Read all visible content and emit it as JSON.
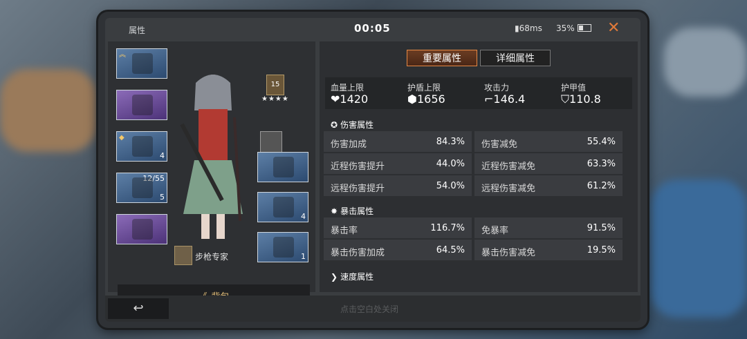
{
  "window": {
    "title": "属性",
    "time": "00:05",
    "ping": "68ms",
    "battery": "35%"
  },
  "tabs": [
    {
      "label": "重要属性",
      "active": true
    },
    {
      "label": "详细属性",
      "active": false
    }
  ],
  "summary": [
    {
      "label": "血量上限",
      "value": "1420",
      "icon": "heart-icon"
    },
    {
      "label": "护盾上限",
      "value": "1656",
      "icon": "shield-icon"
    },
    {
      "label": "攻击力",
      "value": "146.4",
      "icon": "gun-icon"
    },
    {
      "label": "护甲值",
      "value": "110.8",
      "icon": "armor-icon"
    }
  ],
  "sections": {
    "damage": {
      "title": "伤害属性",
      "rows": [
        [
          {
            "label": "伤害加成",
            "value": "84.3%"
          },
          {
            "label": "伤害减免",
            "value": "55.4%"
          }
        ],
        [
          {
            "label": "近程伤害提升",
            "value": "44.0%"
          },
          {
            "label": "近程伤害减免",
            "value": "63.3%"
          }
        ],
        [
          {
            "label": "远程伤害提升",
            "value": "54.0%"
          },
          {
            "label": "远程伤害减免",
            "value": "61.2%"
          }
        ]
      ]
    },
    "crit": {
      "title": "暴击属性",
      "rows": [
        [
          {
            "label": "暴击率",
            "value": "116.7%"
          },
          {
            "label": "免暴率",
            "value": "91.5%"
          }
        ],
        [
          {
            "label": "暴击伤害加成",
            "value": "64.5%"
          },
          {
            "label": "暴击伤害减免",
            "value": "19.5%"
          }
        ]
      ]
    },
    "speed": {
      "title": "速度属性"
    }
  },
  "character": {
    "level": "15",
    "stars": "★★★★",
    "spec": "步枪专家"
  },
  "slots": {
    "weapon1_ammo": "12/55",
    "weapon1_level": "5",
    "weapon2_level": "4",
    "armor_level": "4",
    "helmet_level": "1"
  },
  "bag_label": "背包",
  "hint": "点击空白处关闭"
}
